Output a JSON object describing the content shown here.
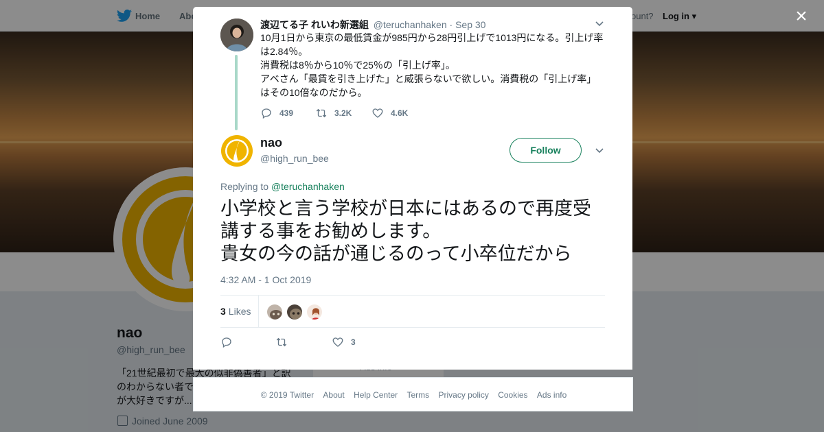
{
  "background_page": {
    "nav": {
      "home": "Home",
      "about": "Abo",
      "account_prompt": "ccount?",
      "login": "Log in"
    },
    "profile": {
      "name": "nao",
      "handle": "@high_run_bee",
      "bio_lines": [
        "「21世紀最初で最大の似非偽善者」と訳",
        "のわからない者で",
        "が大好きですが..."
      ],
      "joined": "Joined June 2009",
      "card_text": "Ads info"
    }
  },
  "modal": {
    "close_label": "×",
    "parent_tweet": {
      "name": "渡辺てる子 れいわ新選組",
      "handle": "@teruchanhaken",
      "date": "· Sep 30",
      "lines": [
        "10月1日から東京の最低賃金が985円から28円引上げで1013円になる。引上げ率",
        "は2.84％。",
        "消費税は8％から10％で25％の「引上げ率」。",
        "アベさん「最賃を引き上げた」と威張らないで欲しい。消費税の「引上げ率」",
        "はその10倍なのだから。"
      ],
      "replies": "439",
      "retweets": "3.2K",
      "likes": "4.6K"
    },
    "main_tweet": {
      "name": "nao",
      "handle": "@high_run_bee",
      "follow_label": "Follow",
      "replying_prefix": "Replying to",
      "replying_to": "@teruchanhaken",
      "lines": [
        "小学校と言う学校が日本にはあるので再度受",
        "講する事をお勧めします。",
        "貴女の今の話が通じるのって小卒位だから"
      ],
      "timestamp": "4:32 AM - 1 Oct 2019",
      "likes_count": "3",
      "likes_label": "Likes",
      "like_action_count": "3"
    }
  },
  "footer": {
    "links": [
      "© 2019 Twitter",
      "About",
      "Help Center",
      "Terms",
      "Privacy policy",
      "Cookies",
      "Ads info"
    ]
  },
  "colors": {
    "accent": "#17805c",
    "text_secondary": "#657786",
    "thread_line": "#a8d8c8"
  }
}
